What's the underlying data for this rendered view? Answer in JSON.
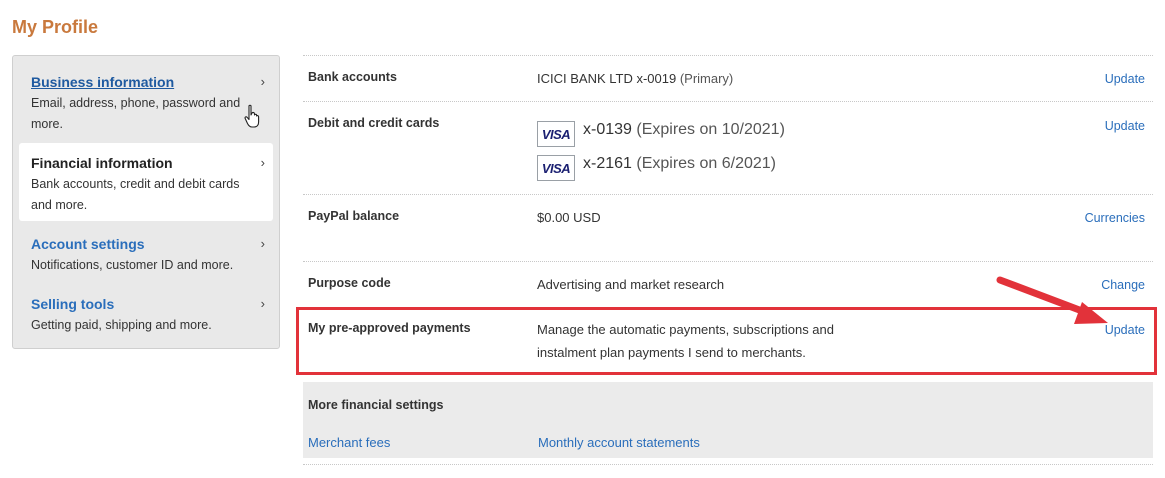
{
  "page": {
    "title": "My Profile"
  },
  "sidebar": {
    "items": [
      {
        "title": "Business information",
        "desc": "Email, address, phone, password and more."
      },
      {
        "title": "Financial information",
        "desc": "Bank accounts, credit and debit cards and more."
      },
      {
        "title": "Account settings",
        "desc": "Notifications, customer ID and more."
      },
      {
        "title": "Selling tools",
        "desc": "Getting paid, shipping and more."
      }
    ],
    "chevron": "›",
    "active_index": 1
  },
  "rows": {
    "bank": {
      "label": "Bank accounts",
      "value": "ICICI BANK LTD x-0019",
      "suffix": "(Primary)",
      "action": "Update"
    },
    "cards": {
      "label": "Debit and credit cards",
      "items": [
        {
          "brand": "VISA",
          "number": "x-0139",
          "expiry": "(Expires on 10/2021)"
        },
        {
          "brand": "VISA",
          "number": "x-2161",
          "expiry": "(Expires on 6/2021)"
        }
      ],
      "action": "Update"
    },
    "balance": {
      "label": "PayPal balance",
      "value": "$0.00 USD",
      "action": "Currencies"
    },
    "purpose": {
      "label": "Purpose code",
      "value": "Advertising and market research",
      "action": "Change"
    },
    "preapproved": {
      "label": "My pre-approved payments",
      "line1": "Manage the automatic payments, subscriptions and",
      "line2": "instalment plan payments I send to merchants.",
      "action": "Update"
    }
  },
  "more": {
    "title": "More financial settings",
    "links": [
      "Merchant fees",
      "Monthly account statements"
    ]
  },
  "colors": {
    "brand_title": "#c9793d",
    "link": "#2a6ebb",
    "highlight": "#e2323a"
  },
  "icons": {
    "pointer": "hand-pointer-icon",
    "arrow": "red-arrow-annotation-icon"
  }
}
